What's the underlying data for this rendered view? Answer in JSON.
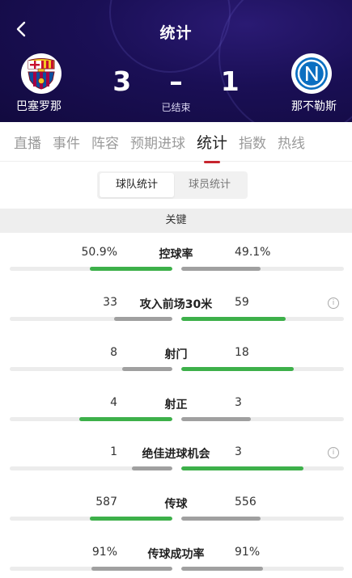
{
  "header": {
    "title": "统计",
    "home_team": "巴塞罗那",
    "away_team": "那不勒斯",
    "home_score": "3",
    "separator": "–",
    "away_score": "1",
    "status": "已结束"
  },
  "tabs": [
    {
      "label": "直播",
      "active": false
    },
    {
      "label": "事件",
      "active": false
    },
    {
      "label": "阵容",
      "active": false
    },
    {
      "label": "预期进球",
      "active": false
    },
    {
      "label": "统计",
      "active": true
    },
    {
      "label": "指数",
      "active": false
    },
    {
      "label": "热线",
      "active": false
    }
  ],
  "segment": {
    "team_stats": "球队统计",
    "player_stats": "球员统计",
    "selected": "team_stats"
  },
  "section": {
    "title": "关键"
  },
  "stats": [
    {
      "label": "控球率",
      "left": "50.9%",
      "right": "49.1%",
      "left_fill": 0.51,
      "right_fill": 0.49,
      "leader": "left",
      "info": false
    },
    {
      "label": "攻入前场30米",
      "left": "33",
      "right": "59",
      "left_fill": 0.36,
      "right_fill": 0.64,
      "leader": "right",
      "info": true
    },
    {
      "label": "射门",
      "left": "8",
      "right": "18",
      "left_fill": 0.31,
      "right_fill": 0.69,
      "leader": "right",
      "info": false
    },
    {
      "label": "射正",
      "left": "4",
      "right": "3",
      "left_fill": 0.57,
      "right_fill": 0.43,
      "leader": "left",
      "info": false
    },
    {
      "label": "绝佳进球机会",
      "left": "1",
      "right": "3",
      "left_fill": 0.25,
      "right_fill": 0.75,
      "leader": "right",
      "info": true
    },
    {
      "label": "传球",
      "left": "587",
      "right": "556",
      "left_fill": 0.51,
      "right_fill": 0.49,
      "leader": "left",
      "info": false
    },
    {
      "label": "传球成功率",
      "left": "91%",
      "right": "91%",
      "left_fill": 0.5,
      "right_fill": 0.5,
      "leader": "none",
      "info": false
    }
  ],
  "colors": {
    "leader": "#3db04a",
    "other": "#a0a0a0",
    "accent": "#c7252e",
    "header": "#1a0f55"
  },
  "icons": {
    "back": "chevron-left-icon",
    "info": "info-icon",
    "home_logo": "barcelona-crest-icon",
    "away_logo": "napoli-crest-icon"
  }
}
